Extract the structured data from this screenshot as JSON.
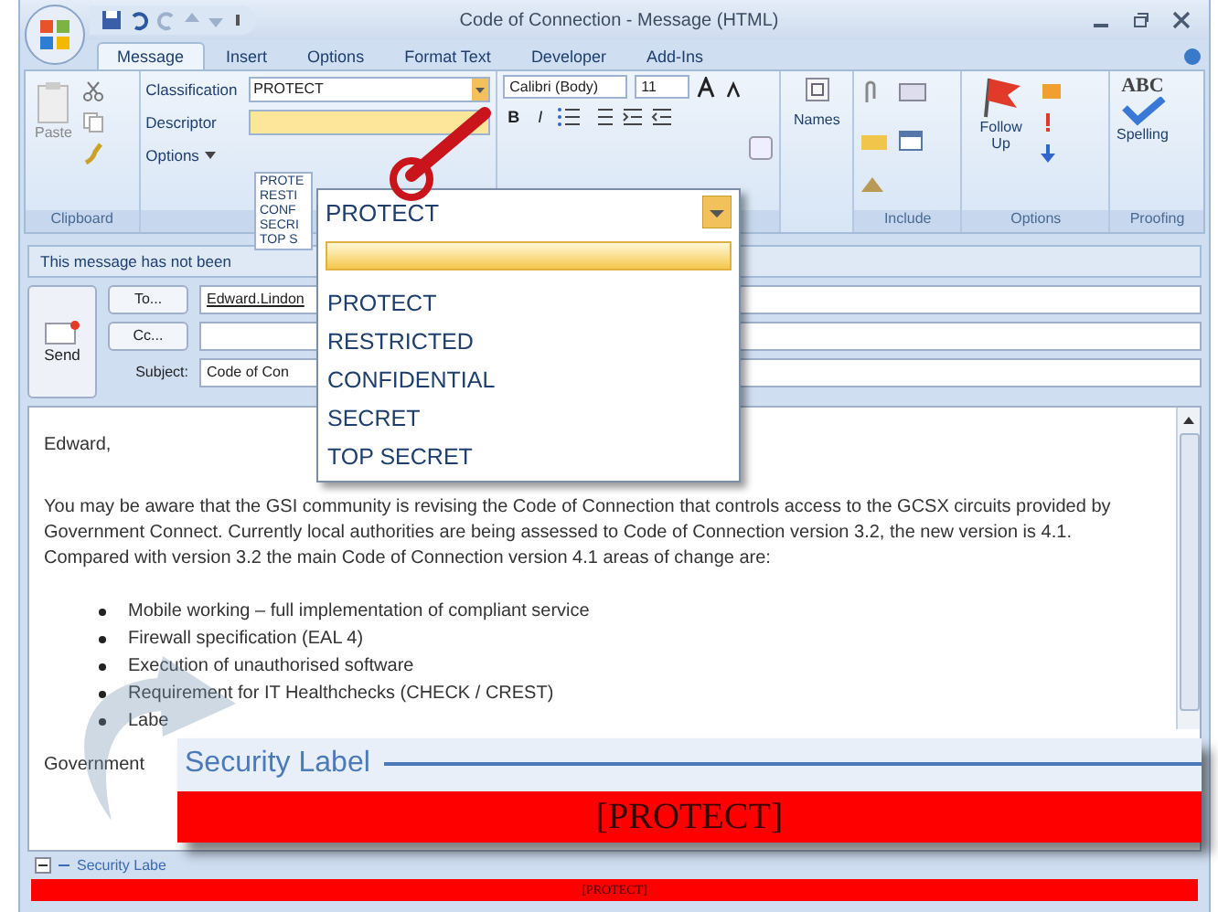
{
  "window": {
    "title": "Code of Connection - Message (HTML)"
  },
  "tabs": [
    {
      "label": "Message",
      "selected": true
    },
    {
      "label": "Insert",
      "selected": false
    },
    {
      "label": "Options",
      "selected": false
    },
    {
      "label": "Format Text",
      "selected": false
    },
    {
      "label": "Developer",
      "selected": false
    },
    {
      "label": "Add-Ins",
      "selected": false
    }
  ],
  "ribbon": {
    "paste": "Paste",
    "clipboard_label": "Clipboard",
    "classification_label": "Classification",
    "classification_value": "PROTECT",
    "descriptor_label": "Descriptor",
    "options_menu": "Options",
    "classification_list": [
      "PROTE",
      "RESTI",
      "CONF",
      "SECRI",
      "TOP S"
    ],
    "font_family": "Calibri (Body)",
    "font_size": "11",
    "bold": "B",
    "italic": "I",
    "names": "Names",
    "include_label": "Include",
    "follow_up": "Follow Up",
    "options_label": "Options",
    "spelling_icon": "ABC",
    "spelling": "Spelling",
    "proofing_label": "Proofing"
  },
  "info_bar": "This message has not been",
  "header": {
    "send": "Send",
    "to_button": "To...",
    "to_value": "Edward.Lindon",
    "cc_button": "Cc...",
    "subject_label": "Subject:",
    "subject_value": "Code of Con"
  },
  "body": {
    "greeting": "Edward,",
    "paragraph": "You may be aware that the GSI community is revising the Code of Connection that controls access to the GCSX circuits provided by Government Connect. Currently local authorities are being assessed to Code of Connection version 3.2, the new version is 4.1. Compared with version 3.2 the main Code of Connection version 4.1 areas of change are:",
    "bullets": [
      "Mobile working – full implementation of compliant service",
      "Firewall specification (EAL 4)",
      "Execution of unauthorised software",
      "Requirement for IT Healthchecks (CHECK / CREST)",
      "Labe"
    ],
    "closing": "Government"
  },
  "security_label": {
    "title": "Security Labe",
    "value": "[PROTECT]"
  },
  "magnified_dropdown": {
    "value": "PROTECT",
    "items": [
      "PROTECT",
      "RESTRICTED",
      "CONFIDENTIAL",
      "SECRET",
      "TOP SECRET"
    ]
  },
  "callout": {
    "title": "Security Label",
    "value": "[PROTECT]"
  }
}
